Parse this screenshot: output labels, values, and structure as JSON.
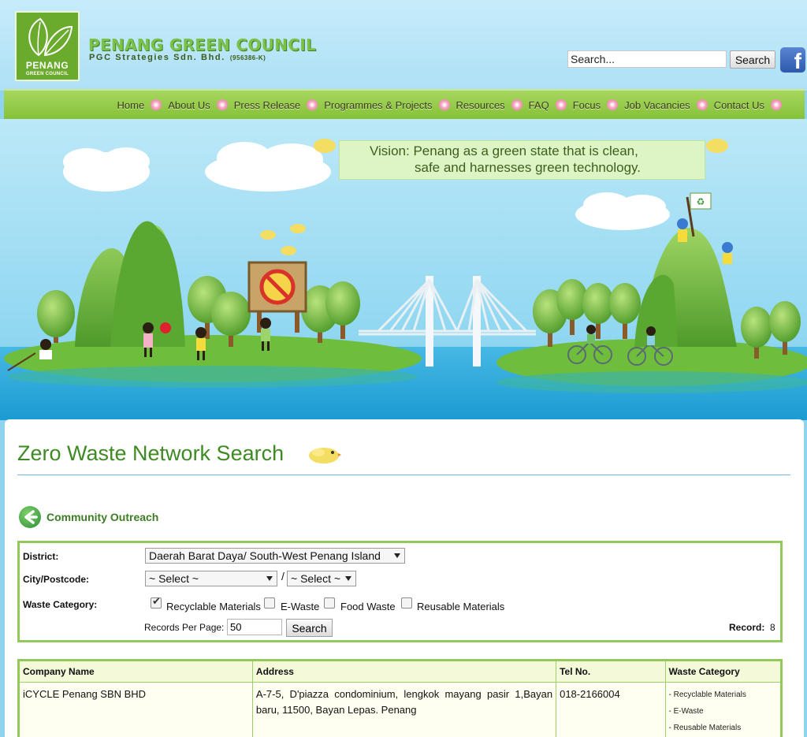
{
  "header": {
    "logo_word": "PENANG",
    "logo_sub": "GREEN COUNCIL",
    "org_name": "PENANG GREEN COUNCIL",
    "org_sub": "PGC Strategies Sdn. Bhd.",
    "org_code": "(956386-K)",
    "search_placeholder": "Search...",
    "search_button": "Search",
    "facebook_glyph": "f"
  },
  "nav": {
    "items": [
      "Home",
      "About Us",
      "Press Release",
      "Programmes & Projects",
      "Resources",
      "FAQ",
      "Focus",
      "Job Vacancies",
      "Contact Us"
    ]
  },
  "banner": {
    "vision_line1": "Vision: Penang as a green state that is clean,",
    "vision_line2": "safe and harnesses green technology."
  },
  "page": {
    "title": "Zero Waste Network Search",
    "back_link": "Community Outreach"
  },
  "filters": {
    "district_label": "District:",
    "district_value": "Daerah Barat Daya/ South-West Penang Island",
    "city_label": "City/Postcode:",
    "city_value": "~ Select ~",
    "postcode_value": "~ Select ~",
    "slash": "/",
    "waste_label": "Waste Category:",
    "categories": [
      {
        "label": "Recyclable Materials",
        "checked": true
      },
      {
        "label": "E-Waste",
        "checked": false
      },
      {
        "label": "Food Waste",
        "checked": false
      },
      {
        "label": "Reusable Materials",
        "checked": false
      }
    ],
    "rpp_label": "Records Per Page:",
    "rpp_value": "50",
    "search_button": "Search",
    "record_label": "Record:",
    "record_value": "8"
  },
  "table": {
    "headers": [
      "Company Name",
      "Address",
      "Tel No.",
      "Waste Category"
    ],
    "rows": [
      {
        "company": "iCYCLE Penang SBN BHD",
        "address": "A-7-5, D'piazza condominium, lengkok mayang pasir 1,Bayan baru, 11500, Bayan Lepas. Penang",
        "tel": "018-2166004",
        "categories": [
          "- Recyclable Materials",
          "- E-Waste",
          "- Reusable Materials"
        ]
      }
    ]
  },
  "colors": {
    "brand_green": "#3e8a23",
    "nav_green": "#93c95a",
    "sky": "#8fd3ef",
    "nav_dot_pink": "#e96f99"
  }
}
